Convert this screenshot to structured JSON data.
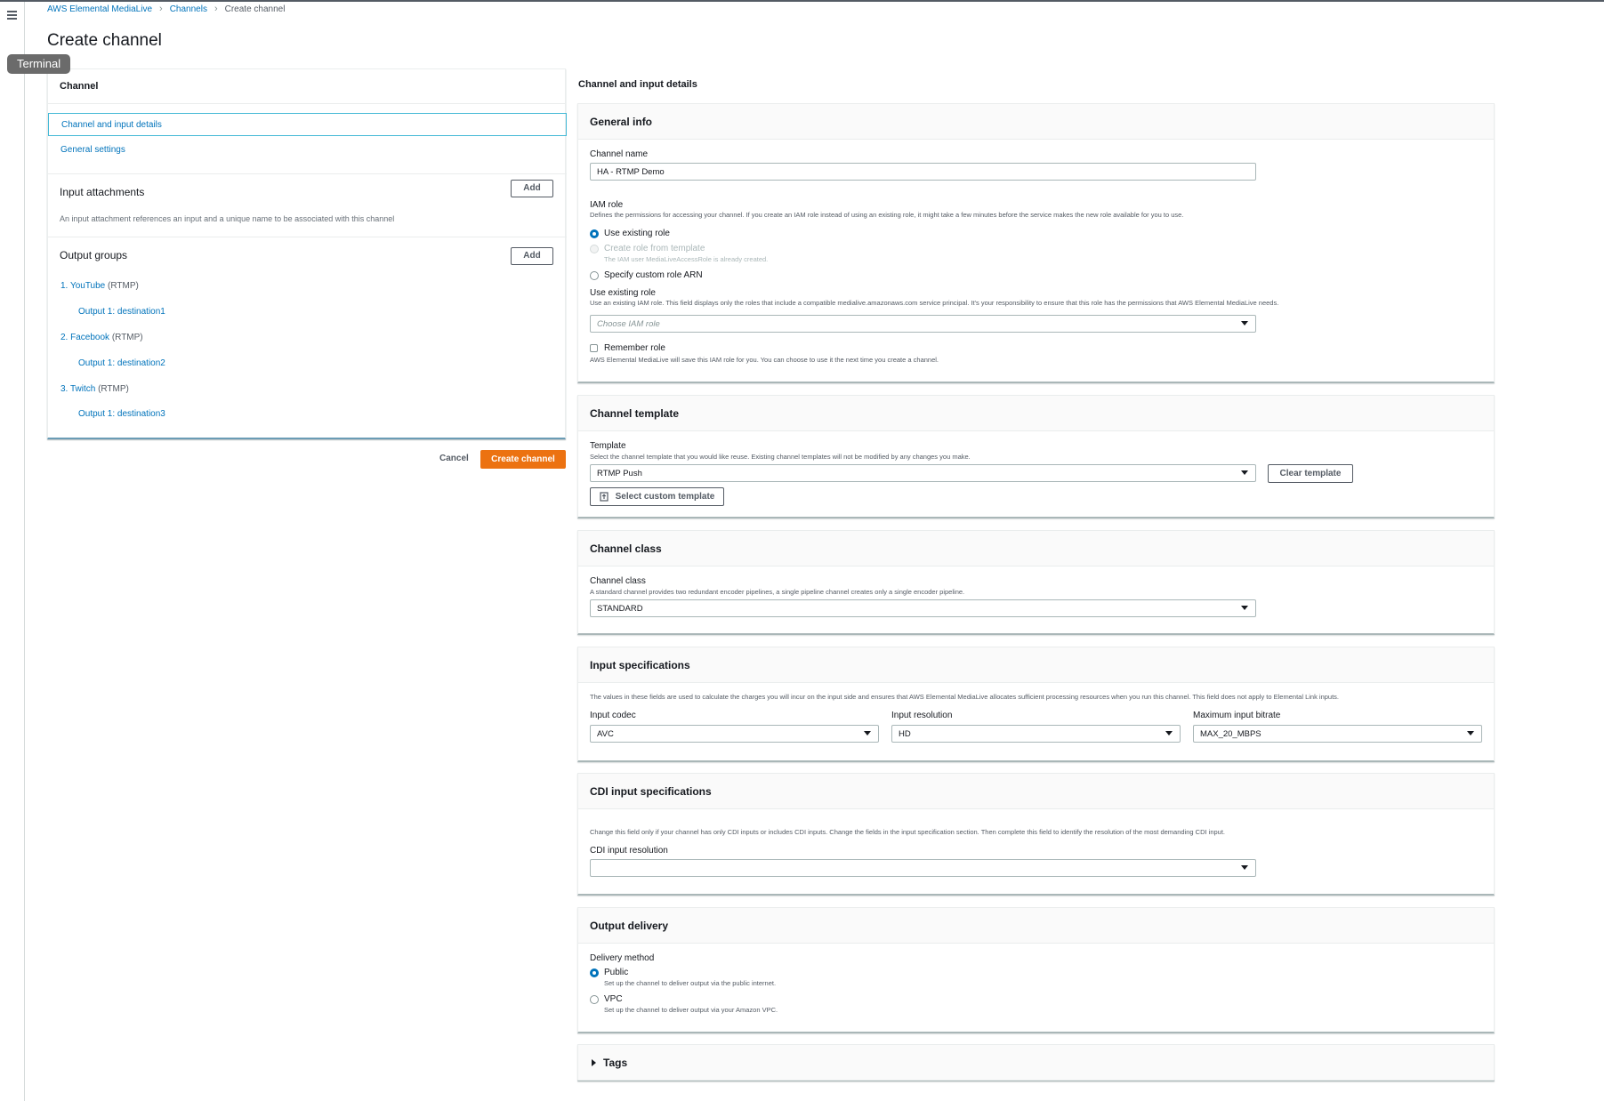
{
  "breadcrumb": [
    "AWS Elemental MediaLive",
    "Channels",
    "Create channel"
  ],
  "page_title": "Create channel",
  "tooltip": "Terminal",
  "left_panel": {
    "title": "Channel",
    "nav": [
      "Channel and input details",
      "General settings"
    ],
    "input_attachments": {
      "title": "Input attachments",
      "add_label": "Add",
      "description": "An input attachment references an input and a unique name to be associated with this channel"
    },
    "output_groups": {
      "title": "Output groups",
      "add_label": "Add",
      "groups": [
        {
          "name": "1. YouTube",
          "protocol": "(RTMP)",
          "output": "Output 1: destination1"
        },
        {
          "name": "2. Facebook",
          "protocol": "(RTMP)",
          "output": "Output 1: destination2"
        },
        {
          "name": "3. Twitch",
          "protocol": "(RTMP)",
          "output": "Output 1: destination3"
        }
      ]
    }
  },
  "actions": {
    "cancel": "Cancel",
    "create": "Create channel"
  },
  "right": {
    "section_title": "Channel and input details",
    "general_info": {
      "title": "General info",
      "channel_name_label": "Channel name",
      "channel_name_value": "HA - RTMP Demo",
      "iam_role_label": "IAM role",
      "iam_role_desc": "Defines the permissions for accessing your channel. If you create an IAM role instead of using an existing role, it might take a few minutes before the service makes the new role available for you to use.",
      "options": [
        "Use existing role",
        "Create role from template",
        "Specify custom role ARN"
      ],
      "create_role_note": "The IAM user MediaLiveAccessRole is already created.",
      "use_existing_label": "Use existing role",
      "use_existing_desc": "Use an existing IAM role. This field displays only the roles that include a compatible medialive.amazonaws.com service principal. It's your responsibility to ensure that this role has the permissions that AWS Elemental MediaLive needs.",
      "iam_placeholder": "Choose IAM role",
      "remember_label": "Remember role",
      "remember_desc": "AWS Elemental MediaLive will save this IAM role for you. You can choose to use it the next time you create a channel."
    },
    "channel_template": {
      "title": "Channel template",
      "template_label": "Template",
      "template_desc": "Select the channel template that you would like reuse. Existing channel templates will not be modified by any changes you make.",
      "template_value": "RTMP Push",
      "clear_label": "Clear template",
      "custom_label": "Select custom template"
    },
    "channel_class": {
      "title": "Channel class",
      "label": "Channel class",
      "desc": "A standard channel provides two redundant encoder pipelines, a single pipeline channel creates only a single encoder pipeline.",
      "value": "STANDARD"
    },
    "input_specs": {
      "title": "Input specifications",
      "desc": "The values in these fields are used to calculate the charges you will incur on the input side and ensures that AWS Elemental MediaLive allocates sufficient processing resources when you run this channel. This field does not apply to Elemental Link inputs.",
      "codec_label": "Input codec",
      "codec_value": "AVC",
      "resolution_label": "Input resolution",
      "resolution_value": "HD",
      "bitrate_label": "Maximum input bitrate",
      "bitrate_value": "MAX_20_MBPS"
    },
    "cdi_specs": {
      "title": "CDI input specifications",
      "desc": "Change this field only if your channel has only CDI inputs or includes CDI inputs. Change the fields in the input specification section. Then complete this field to identify the resolution of the most demanding CDI input.",
      "label": "CDI input resolution",
      "value": ""
    },
    "output_delivery": {
      "title": "Output delivery",
      "method_label": "Delivery method",
      "public_label": "Public",
      "public_desc": "Set up the channel to deliver output via the public internet.",
      "vpc_label": "VPC",
      "vpc_desc": "Set up the channel to deliver output via your Amazon VPC."
    },
    "tags": {
      "title": "Tags"
    }
  },
  "colors": {
    "link": "#0073bb",
    "primary": "#ec7211",
    "focus": "#44b9d6"
  }
}
